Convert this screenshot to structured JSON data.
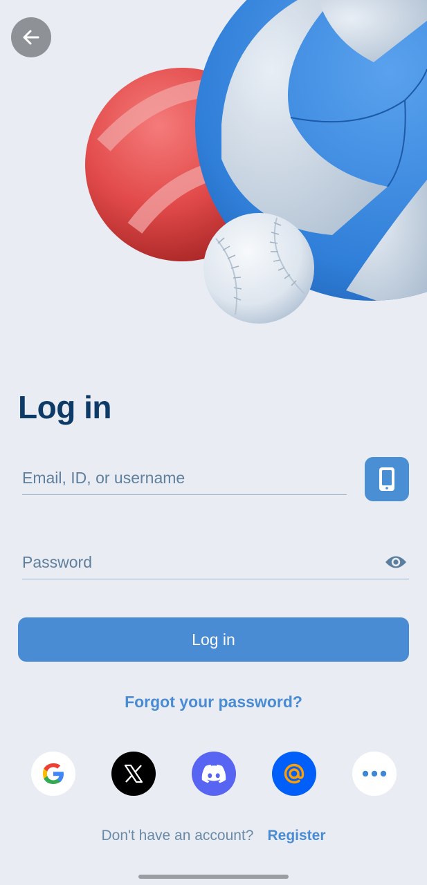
{
  "header": {
    "back_icon": "arrow-left-icon",
    "hero_icons": [
      "red-ball-icon",
      "volleyball-icon",
      "baseball-icon"
    ]
  },
  "login": {
    "title": "Log in",
    "email_placeholder": "Email, ID, or username",
    "email_value": "",
    "phone_icon": "phone-icon",
    "password_placeholder": "Password",
    "password_value": "",
    "eye_icon": "eye-icon",
    "submit_label": "Log in",
    "forgot_label": "Forgot your password?"
  },
  "social": {
    "providers": [
      {
        "icon": "google-icon",
        "color": "#ffffff"
      },
      {
        "icon": "x-icon",
        "color": "#000000"
      },
      {
        "icon": "discord-icon",
        "color": "#5865f2"
      },
      {
        "icon": "mail-at-icon",
        "color": "#005ff9"
      },
      {
        "icon": "more-icon",
        "color": "#ffffff"
      }
    ]
  },
  "footer": {
    "prompt": "Don't have an account?",
    "register_label": "Register"
  },
  "colors": {
    "background": "#e9edf3",
    "accent": "#4a8cd3",
    "title": "#0d3a66"
  }
}
